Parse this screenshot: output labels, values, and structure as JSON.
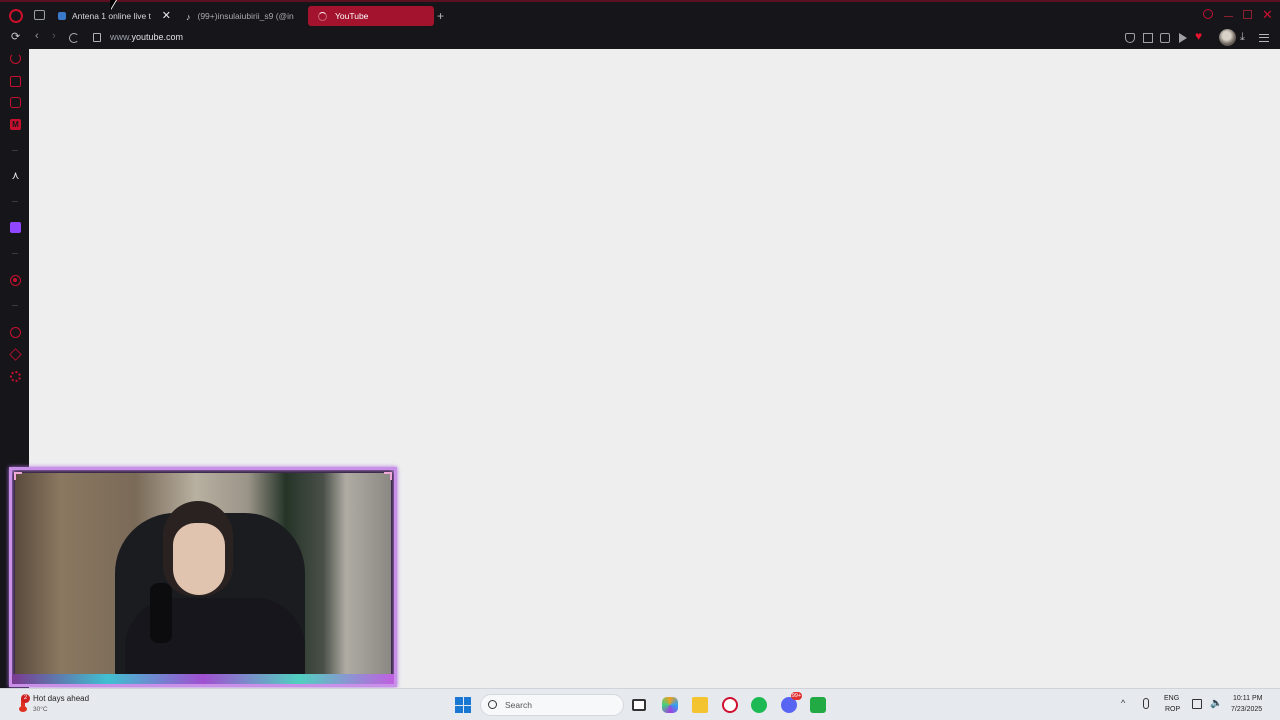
{
  "browser": {
    "tabs": [
      {
        "label": "Antena 1 online live t",
        "active": false
      },
      {
        "label": "(99+)insulaiubirii_s9 (@in",
        "active": false
      },
      {
        "label": "YouTube",
        "active": true
      }
    ],
    "new_tab_glyph": "+",
    "close_glyph": "✕",
    "url_scheme_prefix": "www.",
    "url_host": "youtube.com",
    "accent_color": "#a3132e",
    "nav": {
      "reload": "⟳",
      "back": "‹",
      "forward": "›"
    },
    "toolbar_icons": [
      "pin-icon",
      "snapshot-icon",
      "extensions-icon",
      "player-icon",
      "heart-icon",
      "profile-avatar",
      "download-icon",
      "menu-icon"
    ],
    "download_glyph": "⤓",
    "heart_glyph": "♥"
  },
  "sidebar": {
    "icons": [
      "aria-icon",
      "shopping-icon",
      "messenger-icon",
      "m-app-icon",
      "ai-triangle-icon",
      "twitch-icon",
      "record-icon",
      "history-icon",
      "cube-icon",
      "settings-icon"
    ],
    "m_letter": "M",
    "tri_glyph": "⋏"
  },
  "taskbar": {
    "weather": {
      "title": "Hot days ahead",
      "temp": "30°C",
      "badge": "2"
    },
    "search_placeholder": "Search",
    "discord_badge": "99+",
    "tray": {
      "chevron": "^",
      "lang_1": "ENG",
      "lang_2": "ROP",
      "volume_glyph": "🔈"
    },
    "clock": {
      "time": "10:11 PM",
      "date": "7/23/2025"
    }
  }
}
